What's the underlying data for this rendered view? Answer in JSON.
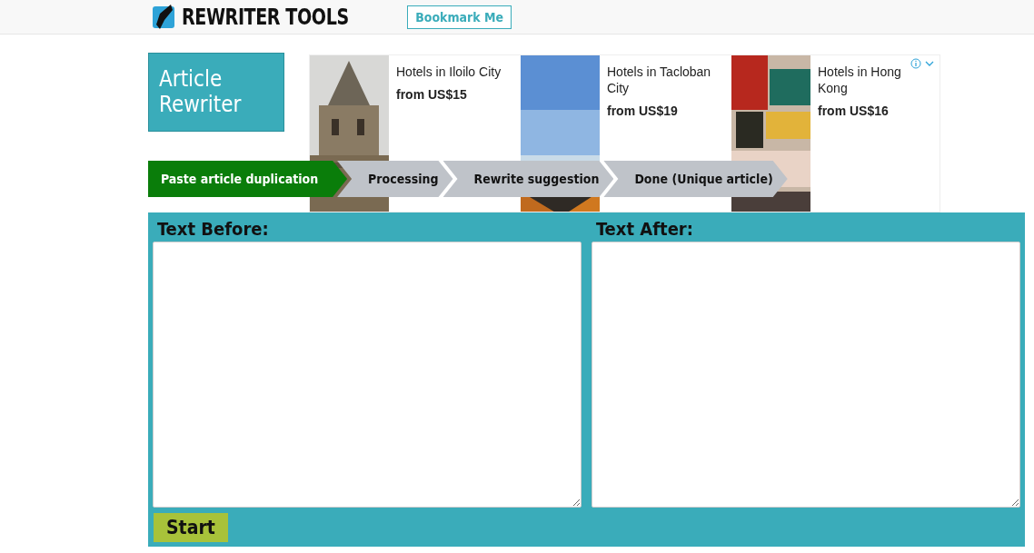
{
  "header": {
    "logo_text": "REWRITER TOOLS",
    "bookmark_button": "Bookmark Me"
  },
  "tool_title": "Article Rewriter",
  "ad": {
    "cards": [
      {
        "kind": "tower",
        "title": "Hotels in Iloilo City",
        "price": "from US$15"
      },
      {
        "kind": "sky",
        "title": "Hotels in Tacloban City",
        "price": "from US$19"
      },
      {
        "kind": "city",
        "title": "Hotels in Hong Kong",
        "price": "from US$16"
      }
    ]
  },
  "steps": [
    {
      "label": "Paste article duplication",
      "selected": true
    },
    {
      "label": "Processing",
      "selected": false
    },
    {
      "label": "Rewrite suggestion",
      "selected": false
    },
    {
      "label": "Done (Unique article)",
      "selected": false
    }
  ],
  "editor": {
    "panels": [
      {
        "label": "Text Before:"
      },
      {
        "label": "Text After:"
      }
    ],
    "start_button": "Start"
  }
}
